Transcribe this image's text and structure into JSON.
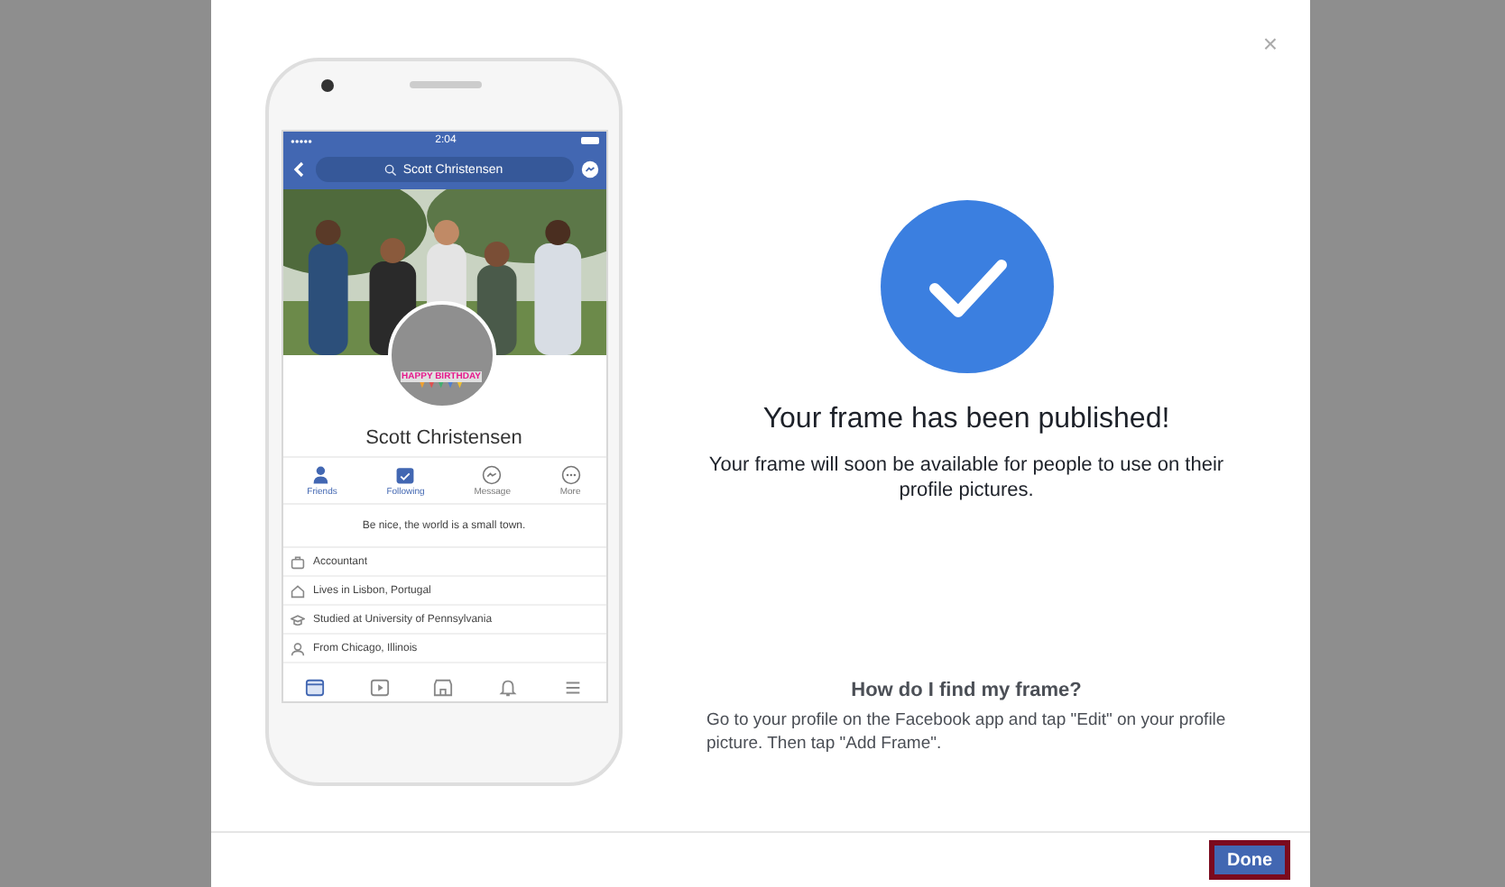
{
  "dialog": {
    "close": "×",
    "phone": {
      "status_time": "2:04",
      "search": "Scott Christensen",
      "frame_text": "HAPPY BIRTHDAY",
      "profile_name": "Scott Christensen",
      "actions": [
        {
          "label": "Friends",
          "kind": "friends",
          "selected": true
        },
        {
          "label": "Following",
          "kind": "following",
          "selected": true
        },
        {
          "label": "Message",
          "kind": "message",
          "selected": false
        },
        {
          "label": "More",
          "kind": "more",
          "selected": false
        }
      ],
      "bio": "Be nice, the world is a small town.",
      "details": [
        {
          "kind": "work",
          "text": "Accountant"
        },
        {
          "kind": "home",
          "text": "Lives in Lisbon, Portugal"
        },
        {
          "kind": "school",
          "text": "Studied at University of Pennsylvania"
        },
        {
          "kind": "from",
          "text": "From Chicago, Illinois"
        }
      ],
      "tabs": [
        {
          "kind": "feed",
          "selected": true
        },
        {
          "kind": "video",
          "selected": false
        },
        {
          "kind": "store",
          "selected": false
        },
        {
          "kind": "bell",
          "selected": false
        },
        {
          "kind": "menu",
          "selected": false
        }
      ]
    },
    "title": "Your frame has been published!",
    "message": "Your frame will soon be available for people to use on their profile pictures.",
    "help_title": "How do I find my frame?",
    "help_text": "Go to your profile on the Facebook app and tap \"Edit\" on your profile picture. Then tap \"Add Frame\".",
    "done": "Done"
  }
}
